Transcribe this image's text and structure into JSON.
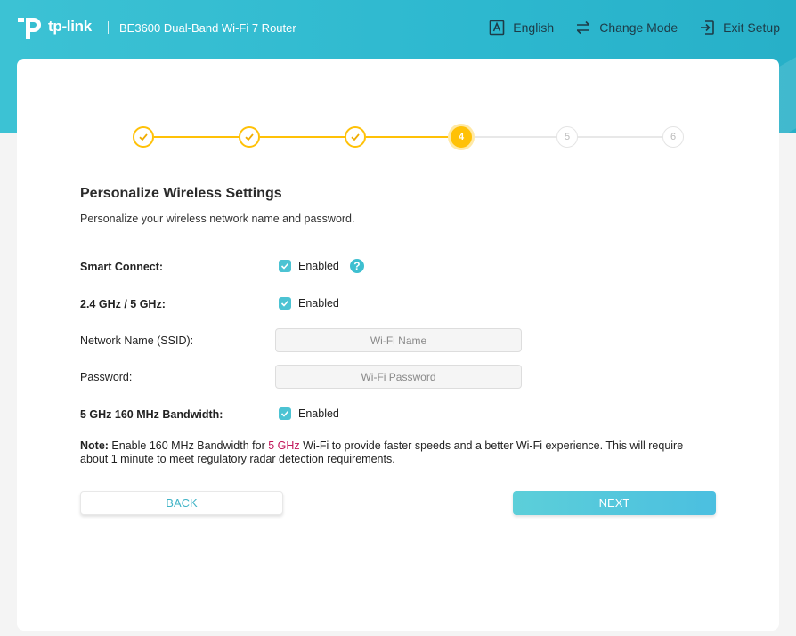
{
  "header": {
    "brand": "tp-link",
    "model": "BE3600 Dual-Band Wi-Fi 7 Router",
    "actions": [
      {
        "label": "English",
        "icon": "language-icon"
      },
      {
        "label": "Change Mode",
        "icon": "change-mode-icon"
      },
      {
        "label": "Exit Setup",
        "icon": "exit-icon"
      }
    ]
  },
  "stepper": {
    "current": 4,
    "steps": [
      {
        "label": "",
        "state": "done"
      },
      {
        "label": "",
        "state": "done"
      },
      {
        "label": "",
        "state": "done"
      },
      {
        "label": "4",
        "state": "active"
      },
      {
        "label": "5",
        "state": "todo"
      },
      {
        "label": "6",
        "state": "todo"
      }
    ]
  },
  "page": {
    "title": "Personalize Wireless Settings",
    "subtitle": "Personalize your wireless network name and password."
  },
  "form": {
    "smart_connect": {
      "label": "Smart Connect:",
      "value": "Enabled",
      "checked": true
    },
    "bands": {
      "label": "2.4 GHz / 5 GHz:",
      "value": "Enabled",
      "checked": true
    },
    "ssid": {
      "label": "Network Name (SSID):",
      "placeholder": "Wi-Fi Name",
      "value": ""
    },
    "password": {
      "label": "Password:",
      "placeholder": "Wi-Fi Password",
      "value": ""
    },
    "bandwidth": {
      "label": "5 GHz 160 MHz Bandwidth:",
      "value": "Enabled",
      "checked": true
    }
  },
  "note": {
    "prefix": "Note:",
    "text_before": " Enable 160 MHz Bandwidth for ",
    "highlight": "5 GHz",
    "text_after": " Wi-Fi to provide faster speeds and a better Wi-Fi experience. This will require about 1 minute to meet regulatory radar detection requirements."
  },
  "buttons": {
    "back": "BACK",
    "next": "NEXT"
  },
  "colors": {
    "brand": "#3cc2d4",
    "step_done": "#ffc107",
    "checkbox": "#4cc3d3",
    "note_highlight": "#c2185b"
  }
}
